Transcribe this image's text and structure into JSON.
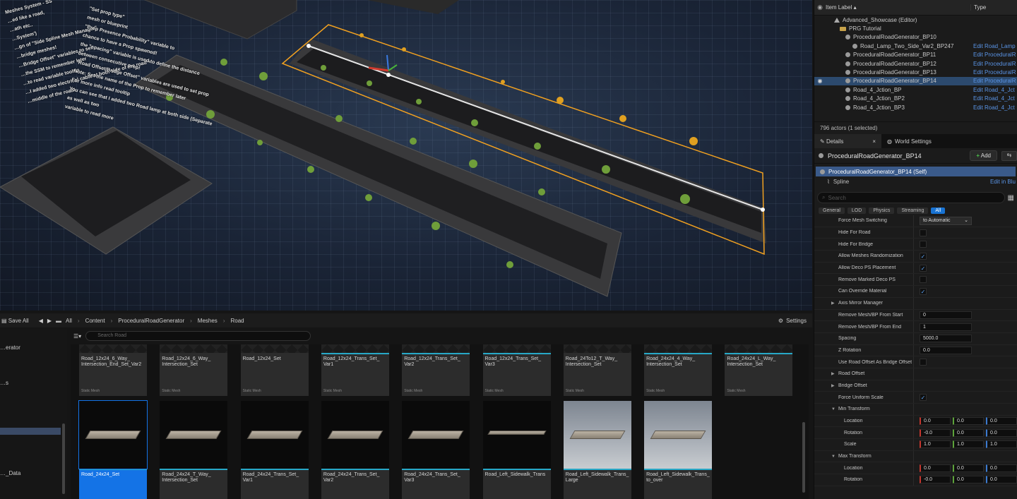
{
  "viewport": {
    "notes_left": [
      "Meshes System - SS",
      "…ed like a road,",
      "…ath etc..",
      "…System')",
      "…gn of \"Side Spline Mesh Manager\"",
      "…bridge meshes!",
      "…Bridge Offset\" variables to set",
      "…the SSM to remember later",
      "…to read variable tooltip",
      "…I added two electrical cable at both side of the road +",
      "…middle of the road!"
    ],
    "notes_right": [
      "\"Set prop type\"",
      "mesh or blueprint",
      "\"Prop Presence Probability\" variable to",
      "chance to have a Prop spawned!",
      "the \"spacing\" variable is used to define the distance",
      "between consecutive prop!",
      "\"Road Offset/Bridge Offset\" variables are used to set prop",
      "Note: Set the name of the Prop to remember later",
      "For more info read tooltip",
      "You can see that I added two Road lamp at both side (Separate",
      "as well as two",
      "variable to read more"
    ]
  },
  "outliner": {
    "col_label": "Item Label ▴",
    "col_type": "Type",
    "rows": [
      {
        "indent": 28,
        "icon": "level",
        "label": "Advanced_Showcase (Editor)",
        "type": "",
        "vis": ""
      },
      {
        "indent": 36,
        "icon": "folder",
        "label": "PRG Tutorial",
        "type": "",
        "vis": ""
      },
      {
        "indent": 44,
        "icon": "actor",
        "label": "ProceduralRoadGenerator_BP10",
        "type": "",
        "vis": ""
      },
      {
        "indent": 54,
        "icon": "actor",
        "label": "Road_Lamp_Two_Side_Var2_BP247",
        "type": "Edit Road_Lamp",
        "vis": ""
      },
      {
        "indent": 44,
        "icon": "actor",
        "label": "ProceduralRoadGenerator_BP11",
        "type": "Edit ProceduralR",
        "vis": ""
      },
      {
        "indent": 44,
        "icon": "actor",
        "label": "ProceduralRoadGenerator_BP12",
        "type": "Edit ProceduralR",
        "vis": ""
      },
      {
        "indent": 44,
        "icon": "actor",
        "label": "ProceduralRoadGenerator_BP13",
        "type": "Edit ProceduralR",
        "vis": ""
      },
      {
        "indent": 44,
        "icon": "actor",
        "label": "ProceduralRoadGenerator_BP14",
        "type": "Edit ProceduralR",
        "vis": "◉",
        "selected": true
      },
      {
        "indent": 44,
        "icon": "actor",
        "label": "Road_4_Jction_BP",
        "type": "Edit Road_4_Jct",
        "vis": ""
      },
      {
        "indent": 44,
        "icon": "actor",
        "label": "Road_4_Jction_BP2",
        "type": "Edit Road_4_Jct",
        "vis": ""
      },
      {
        "indent": 44,
        "icon": "actor",
        "label": "Road_4_Jction_BP3",
        "type": "Edit Road_4_Jct",
        "vis": ""
      }
    ],
    "footer": "796 actors (1 selected)"
  },
  "details": {
    "tab_details": "Details",
    "tab_world": "World Settings",
    "actor_title": "ProceduralRoadGenerator_BP14",
    "add_label": "Add",
    "self_row": "ProceduralRoadGenerator_BP14 (Self)",
    "spline_row": "Spline",
    "spline_link": "Edit in Blu",
    "search_placeholder": "Search",
    "filters": [
      "General",
      "LOD",
      "Physics",
      "Streaming",
      "All"
    ],
    "props": [
      {
        "name": "Force Mesh Switching",
        "kind": "dropdown",
        "value": "to Automatic"
      },
      {
        "name": "Hide For Road",
        "kind": "check",
        "value": ""
      },
      {
        "name": "Hide For Bridge",
        "kind": "check",
        "value": ""
      },
      {
        "name": "Allow Meshes Randomization",
        "kind": "check",
        "value": "✓"
      },
      {
        "name": "Allow Deco PS Placement",
        "kind": "check",
        "value": "✓"
      },
      {
        "name": "Remove Marked Deco PS",
        "kind": "check",
        "value": ""
      },
      {
        "name": "Can Override Material",
        "kind": "check",
        "value": "✓"
      },
      {
        "name": "Axis Mirror Manager",
        "kind": "cat",
        "value": ""
      },
      {
        "name": "Remove Mesh/BP From Start",
        "kind": "num",
        "value": "0"
      },
      {
        "name": "Remove Mesh/BP From End",
        "kind": "num",
        "value": "1"
      },
      {
        "name": "Spacing",
        "kind": "num",
        "value": "5000.0"
      },
      {
        "name": "Z Rotation",
        "kind": "num",
        "value": "0.0"
      },
      {
        "name": "Use Road Offset As Bridge Offset",
        "kind": "check",
        "value": ""
      },
      {
        "name": "Road Offset",
        "kind": "cat",
        "value": ""
      },
      {
        "name": "Bridge Offset",
        "kind": "cat",
        "value": ""
      },
      {
        "name": "Force Uniform Scale",
        "kind": "check",
        "value": "✓"
      },
      {
        "name": "Min Transform",
        "kind": "catopen",
        "value": ""
      },
      {
        "name": "Location",
        "kind": "vec",
        "x": "0.0",
        "y": "0.0",
        "z": "0.0"
      },
      {
        "name": "Rotation",
        "kind": "vec",
        "x": "-0.0",
        "y": "0.0",
        "z": "0.0"
      },
      {
        "name": "Scale",
        "kind": "vec",
        "x": "1.0",
        "y": "1.0",
        "z": "1.0"
      },
      {
        "name": "Max Transform",
        "kind": "catopen",
        "value": ""
      },
      {
        "name": "Location",
        "kind": "vec",
        "x": "0.0",
        "y": "0.0",
        "z": "0.0"
      },
      {
        "name": "Rotation",
        "kind": "vec",
        "x": "-0.0",
        "y": "0.0",
        "z": "0.0"
      }
    ]
  },
  "content_browser": {
    "save_all": "Save All",
    "crumbs": [
      "All",
      "Content",
      "ProceduralRoadGenerator",
      "Meshes",
      "Road"
    ],
    "settings": "Settings",
    "search_placeholder": "Search Road",
    "tree": [
      "…erator",
      "…s",
      "…_Data"
    ],
    "row1": [
      {
        "label": "Road_12x24_6_Way_ Intersection_End_Set_Var2",
        "kind": "Static Mesh",
        "bar": false
      },
      {
        "label": "Road_12x24_6_Way_ Intersection_Set",
        "kind": "Static Mesh",
        "bar": false
      },
      {
        "label": "Road_12x24_Set",
        "kind": "Static Mesh",
        "bar": false
      },
      {
        "label": "Road_12x24_Trans_Set_ Var1",
        "kind": "Static Mesh",
        "bar": true
      },
      {
        "label": "Road_12x24_Trans_Set_ Var2",
        "kind": "Static Mesh",
        "bar": true
      },
      {
        "label": "Road_12x24_Trans_Set_ Var3",
        "kind": "Static Mesh",
        "bar": true
      },
      {
        "label": "Road_24To12_T_Way_ Intersection_Set",
        "kind": "Static Mesh",
        "bar": false
      },
      {
        "label": "Road_24x24_4_Way_ Intersection_Set",
        "kind": "Static Mesh",
        "bar": true
      },
      {
        "label": "Road_24x24_L_Way_ Intersection_Set",
        "kind": "Static Mesh",
        "bar": true
      }
    ],
    "row2": [
      {
        "label": "Road_24x24_Set",
        "thumb": "slab",
        "sel": true
      },
      {
        "label": "Road_24x24_T_Way_ Intersection_Set",
        "thumb": "slab"
      },
      {
        "label": "Road_24x24_Trans_Set_ Var1",
        "thumb": "slab"
      },
      {
        "label": "Road_24x24_Trans_Set_ Var2",
        "thumb": "slab"
      },
      {
        "label": "Road_24x24_Trans_Set_ Var3",
        "thumb": "slab"
      },
      {
        "label": "Road_Left_Sidewalk_Trans",
        "thumb": "thin"
      },
      {
        "label": "Road_Left_Sidewalk_Trans_ Large",
        "thumb": "sky"
      },
      {
        "label": "Road_Left_Sidewalk_Trans_ to_over",
        "thumb": "sky"
      }
    ]
  }
}
